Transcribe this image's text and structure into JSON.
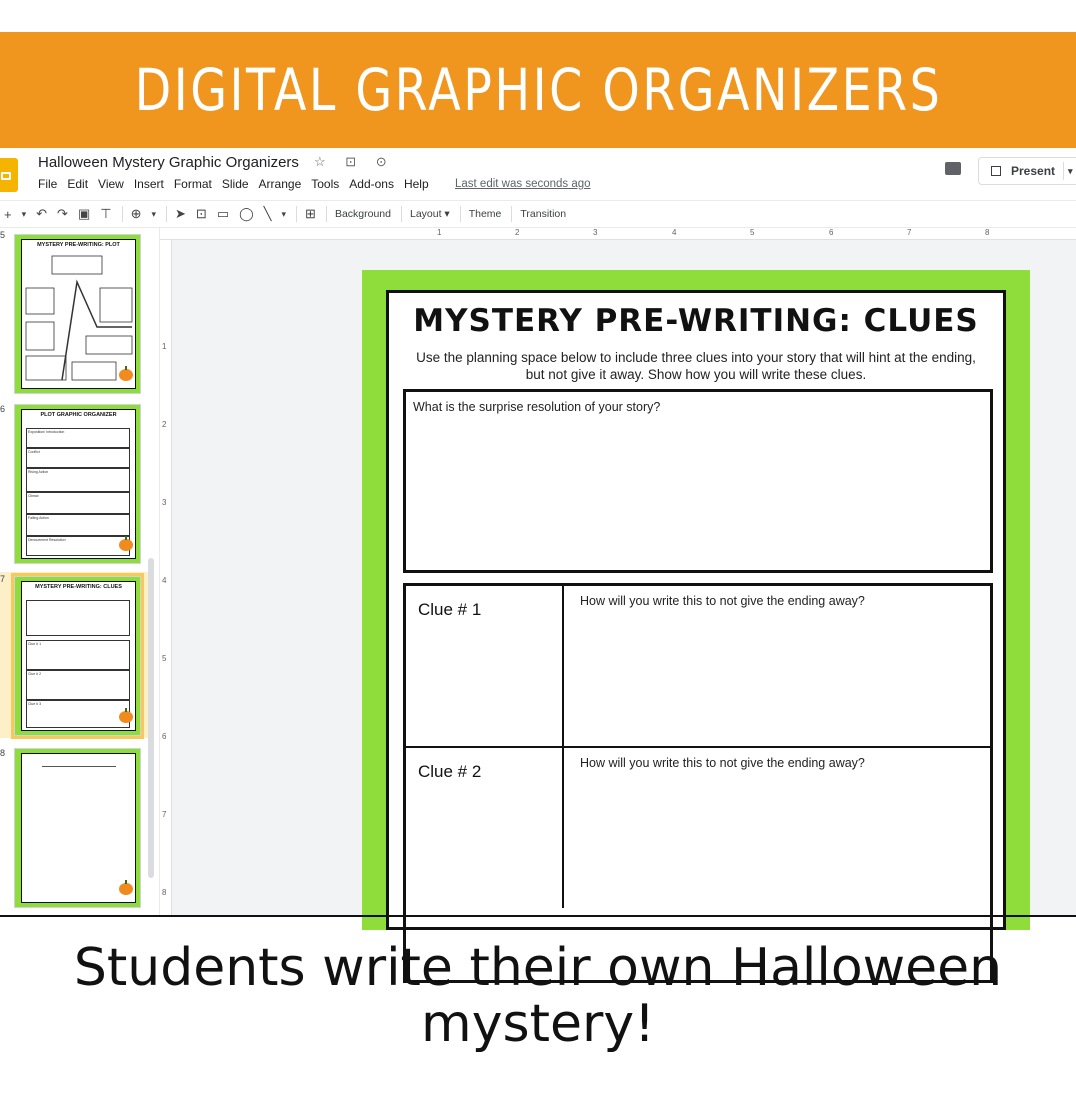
{
  "banner": {
    "title": "DIGITAL GRAPHIC ORGANIZERS",
    "color": "#f0961e"
  },
  "app": {
    "doc_title": "Halloween Mystery Graphic Organizers",
    "title_icons": "☆ ⊡ ⊙",
    "menu": [
      "File",
      "Edit",
      "View",
      "Insert",
      "Format",
      "Slide",
      "Arrange",
      "Tools",
      "Add-ons",
      "Help"
    ],
    "last_edit": "Last edit was seconds ago",
    "present_label": "Present"
  },
  "toolbar": {
    "background": "Background",
    "layout": "Layout ▾",
    "theme": "Theme",
    "transition": "Transition"
  },
  "filmstrip": {
    "slides": [
      {
        "num": "5",
        "title": "MYSTERY PRE-WRITING: PLOT"
      },
      {
        "num": "6",
        "title": "PLOT GRAPHIC ORGANIZER",
        "rows": [
          "Exposition/ Introduction",
          "Conflict",
          "Rising Action",
          "Climax",
          "Falling Action",
          "Denouement Resolution"
        ]
      },
      {
        "num": "7",
        "title": "MYSTERY PRE-WRITING: CLUES",
        "rows": [
          "Clue # 1",
          "Clue # 2",
          "Clue # 3"
        ]
      },
      {
        "num": "8",
        "title": ""
      }
    ]
  },
  "ruler": {
    "top": [
      "1",
      "2",
      "3",
      "4",
      "5",
      "6",
      "7",
      "8"
    ],
    "left": [
      "1",
      "2",
      "3",
      "4",
      "5",
      "6",
      "7",
      "8"
    ]
  },
  "slide": {
    "title": "MYSTERY PRE-WRITING: CLUES",
    "subtitle": "Use the planning space below to include three clues into your story that will hint at the ending, but not give it away.  Show how you will write these clues.",
    "resolution_prompt": "What is the surprise resolution of your story?",
    "clues": [
      {
        "label": "Clue # 1",
        "question": "How will you write this to not give the ending away?"
      },
      {
        "label": "Clue # 2",
        "question": "How will you write this to not give the ending away?"
      }
    ],
    "green": "#8fdd3a"
  },
  "caption": "Students write their own Halloween mystery!"
}
